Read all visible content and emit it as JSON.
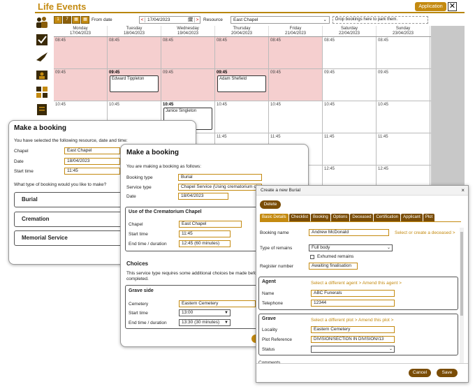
{
  "header": {
    "title": "Life Events",
    "app_button": "Application",
    "close": "✕"
  },
  "toolbar": {
    "view_icons": [
      "1",
      "7",
      "▦",
      "▦"
    ],
    "from_label": "From date",
    "date_value": "17/04/2023",
    "date_prev": "<",
    "date_next": ">",
    "date_icon": "🗓",
    "resource_label": "Resource",
    "resource_value": "East Chapel",
    "park_text": "Drop bookings here to park them."
  },
  "calendar": {
    "days": [
      {
        "name": "Monday",
        "date": "17/04/2023"
      },
      {
        "name": "Tuesday",
        "date": "18/04/2023"
      },
      {
        "name": "Wednesday",
        "date": "19/04/2023"
      },
      {
        "name": "Thursday",
        "date": "20/04/2023"
      },
      {
        "name": "Friday",
        "date": "21/04/2023"
      },
      {
        "name": "Saturday",
        "date": "22/04/2023"
      },
      {
        "name": "Sunday",
        "date": "23/04/2023"
      }
    ],
    "rows": [
      [
        "08:45",
        "08:45",
        "08:45",
        "08:45",
        "08:45",
        "08:45",
        "08:45"
      ],
      [
        "09:45",
        "09:45",
        "09:45",
        "09:45",
        "09:45",
        "09:45",
        "09:45"
      ],
      [
        "10:45",
        "10:45",
        "10:45",
        "10:45",
        "10:45",
        "10:45",
        "10:45"
      ],
      [
        "",
        "",
        "",
        "11:45",
        "11:45",
        "11:45",
        "11:45"
      ],
      [
        "",
        "",
        "",
        "",
        "",
        "12:45",
        "12:45"
      ]
    ],
    "bookings": {
      "tue_0945": "Edward Tippleton",
      "thu_0945": "Adam Shefield",
      "wed_1045": "Janice Singleton"
    }
  },
  "booking1": {
    "title": "Make a booking",
    "intro": "You have selected the following resource, date and time:",
    "chapel_label": "Chapel",
    "chapel_value": "East Chapel",
    "date_label": "Date",
    "date_value": "18/04/2023",
    "start_label": "Start time",
    "start_value": "11:45",
    "question": "What type of booking would you like to make?",
    "options": [
      "Burial",
      "Cremation",
      "Memorial Service"
    ]
  },
  "booking2": {
    "title": "Make a booking",
    "intro": "You are making a booking as follows:",
    "booking_type_label": "Booking type",
    "booking_type_value": "Burial",
    "service_type_label": "Service type",
    "service_type_value": "Chapel Service (Using crematorium cha",
    "date_label": "Date",
    "date_value": "18/04/2023",
    "use_title": "Use of the Crematorium Chapel",
    "chapel_label": "Chapel",
    "chapel_value": "East Chapel",
    "start_label": "Start time",
    "start_value": "11:45",
    "end_label": "End time / duration",
    "end_value": "12:45 (60 minutes)",
    "choices_title": "Choices",
    "choices_text_1": "This service type requires some additional choices be made before",
    "choices_text_2": "completed.",
    "grave_title": "Grave side",
    "cemetery_label": "Cemetery",
    "cemetery_value": "Eastern Cemetery",
    "g_start_label": "Start time",
    "g_start_value": "13:00",
    "g_end_label": "End time / duration",
    "g_end_value": "13:30 (30 minutes)"
  },
  "burial": {
    "title": "Create a new Burial",
    "close": "×",
    "delete_label": "Delete",
    "tabs": [
      "Basic Details",
      "Checklist",
      "Booking",
      "Options",
      "Deceased",
      "Certification",
      "Applicant",
      "Plot"
    ],
    "booking_name_label": "Booking name",
    "booking_name_value": "Andrew McDonald",
    "select_deceased": "Select or create a deceased >",
    "remains_label": "Type of remains",
    "remains_value": "Full body",
    "exhumed_label": "Exhumed remains",
    "register_label": "Register number",
    "register_value": "Awaiting finalisation",
    "agent_title": "Agent",
    "agent_links": "Select a different agent >  Amend this agent >",
    "agent_name_label": "Name",
    "agent_name_value": "ABC Funerals",
    "agent_phone_label": "Telephone",
    "agent_phone_value": "12344",
    "grave_title": "Grave",
    "grave_links": "Select a different plot >  Amend this plot >",
    "locality_label": "Locality",
    "locality_value": "Eastern Cemetery",
    "plotref_label": "Plot Reference",
    "plotref_value": "DIVISION/SECTION IN DIVISION//13",
    "status_label": "Status",
    "status_value": "",
    "comments_label": "Comments",
    "cancel_label": "Cancel",
    "save_label": "Save"
  }
}
